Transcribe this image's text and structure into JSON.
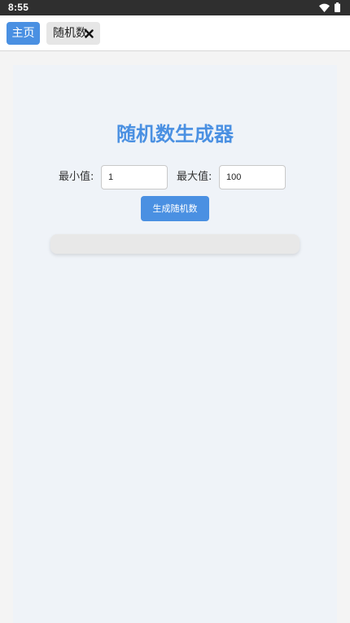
{
  "status_bar": {
    "time": "8:55",
    "icons": [
      "wifi-icon",
      "battery-icon"
    ]
  },
  "tabs": {
    "home_label": "主页",
    "random_label": "随机数",
    "close_icon": "close-icon",
    "active_color": "#4a90e2"
  },
  "main": {
    "title": "随机数生成器",
    "min_label": "最小值:",
    "min_value": "1",
    "max_label": "最大值:",
    "max_value": "100",
    "generate_label": "生成随机数",
    "result": ""
  }
}
